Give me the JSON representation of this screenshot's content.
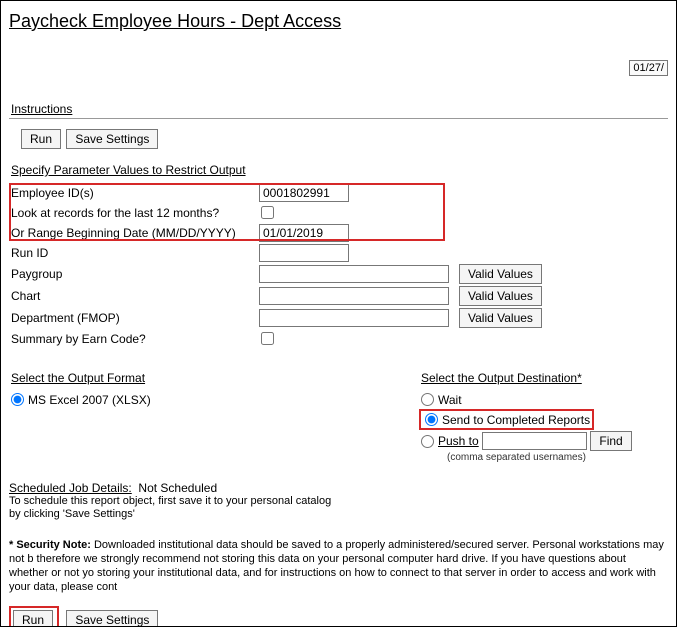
{
  "title": "Paycheck Employee Hours - Dept Access",
  "date_display": "01/27/",
  "instructions_label": "Instructions",
  "buttons": {
    "run": "Run",
    "save_settings": "Save Settings",
    "valid_values": "Valid Values",
    "find": "Find"
  },
  "params_header": "Specify Parameter Values to Restrict Output",
  "params": {
    "employee_id": {
      "label": "Employee ID(s)",
      "value": "0001802991"
    },
    "last12": {
      "label": "Look at records for the last 12 months?",
      "checked": false
    },
    "range_begin": {
      "label": "Or Range Beginning Date (MM/DD/YYYY)",
      "value": "01/01/2019"
    },
    "run_id": {
      "label": "Run ID",
      "value": ""
    },
    "paygroup": {
      "label": "Paygroup",
      "value": ""
    },
    "chart": {
      "label": "Chart",
      "value": ""
    },
    "department": {
      "label": "Department (FMOP)",
      "value": ""
    },
    "summary_ec": {
      "label": "Summary by Earn Code?",
      "checked": false
    }
  },
  "output_format": {
    "header": "Select the Output Format",
    "option1": "MS Excel 2007 (XLSX)"
  },
  "destination": {
    "header": "Select the Output Destination*",
    "wait": "Wait",
    "send_completed": "Send to Completed Reports",
    "push_to": "Push to",
    "push_value": "",
    "hint": "(comma separated usernames)"
  },
  "scheduled": {
    "header": "Scheduled Job Details:",
    "status": "Not Scheduled",
    "note1": "To schedule this report object, first save it to your personal catalog",
    "note2": "by clicking 'Save Settings'"
  },
  "security_note_bold": "* Security Note:",
  "security_note": "Downloaded institutional data should be saved to a properly administered/secured server. Personal workstations may not b therefore we strongly recommend not storing this data on your personal computer hard drive. If you have questions about whether or not yo storing your institutional data, and for instructions on how to connect to that server in order to access and work with your data, please cont"
}
